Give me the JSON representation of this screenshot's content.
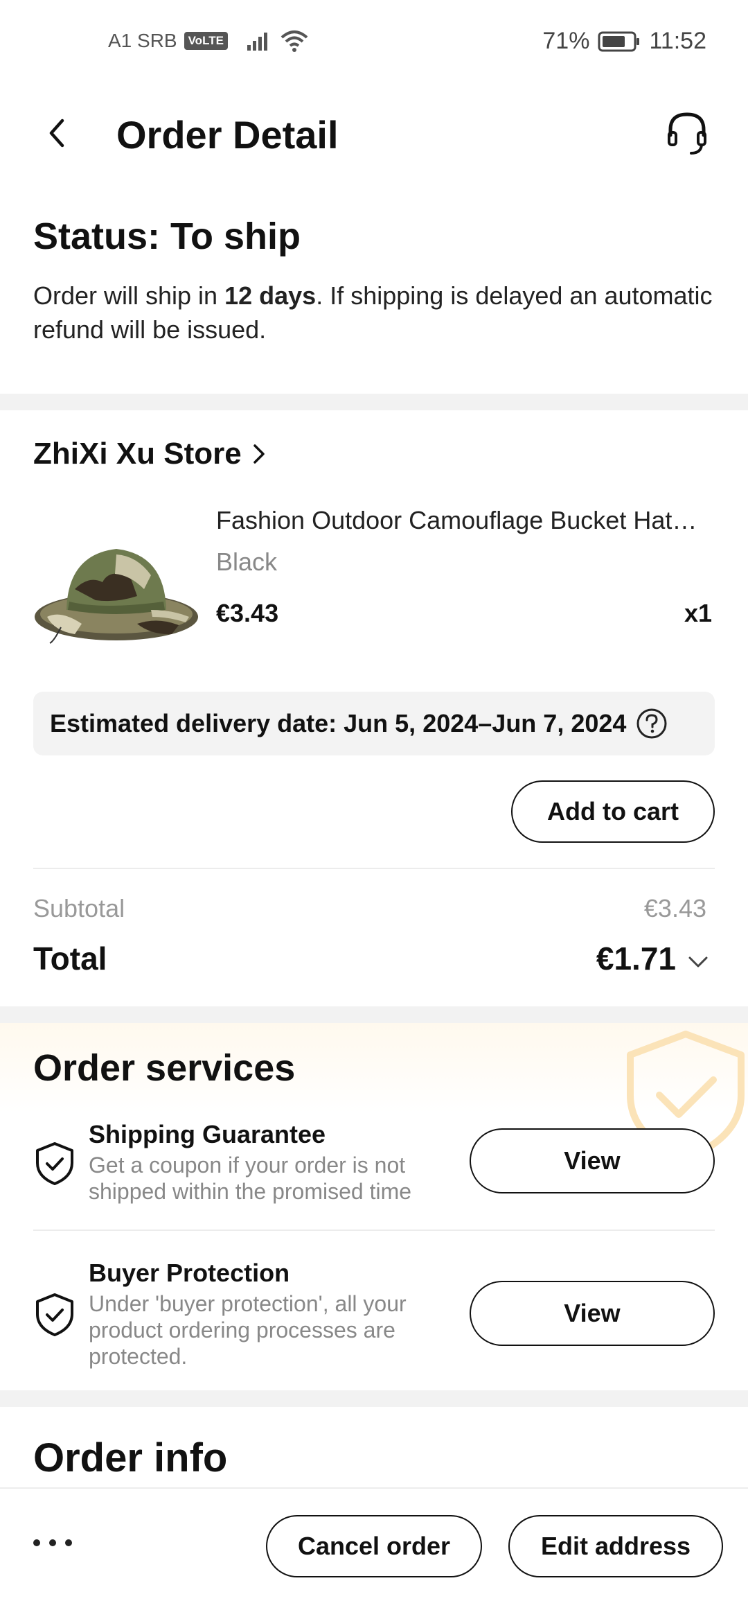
{
  "status_bar": {
    "carrier": "A1 SRB",
    "volte": "VoLTE",
    "battery": "71%",
    "time": "11:52"
  },
  "header": {
    "title": "Order Detail",
    "back_icon": "chevron-left-icon",
    "support_icon": "headset-icon"
  },
  "status": {
    "title": "Status: To ship",
    "desc_before": "Order will ship in ",
    "desc_bold": "12 days",
    "desc_after": ". If shipping is delayed an automatic refund will be issued."
  },
  "store": {
    "name": "ZhiXi Xu Store"
  },
  "product": {
    "title": "Fashion Outdoor Camouflage Bucket Hat…",
    "variant": "Black",
    "price": "€3.43",
    "qty": "x1"
  },
  "delivery": {
    "text": "Estimated delivery date: Jun 5, 2024–Jun 7, 2024"
  },
  "actions": {
    "add_to_cart": "Add to cart"
  },
  "summary": {
    "subtotal_label": "Subtotal",
    "subtotal_value": "€3.43",
    "total_label": "Total",
    "total_value": "€1.71"
  },
  "services": {
    "title": "Order services",
    "items": [
      {
        "name": "Shipping Guarantee",
        "desc": "Get a coupon if your order is not shipped within the promised time",
        "button": "View"
      },
      {
        "name": "Buyer Protection",
        "desc": "Under 'buyer protection', all your product ordering processes are protected.",
        "button": "View"
      }
    ]
  },
  "order_info": {
    "title": "Order info"
  },
  "bottom_bar": {
    "cancel": "Cancel order",
    "edit_address": "Edit address"
  },
  "colors": {
    "text": "#111111",
    "muted": "#888888",
    "band": "#f2f2f2",
    "accent_watermark": "#f6c26b"
  }
}
